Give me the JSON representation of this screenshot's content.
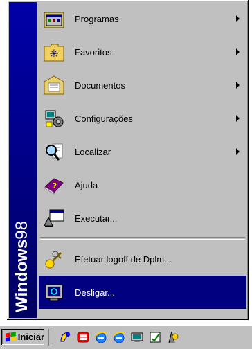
{
  "banner": {
    "brand_bold": "Windows",
    "brand_version": "98"
  },
  "menu": {
    "items": [
      {
        "label": "Programas",
        "underline_char": "P",
        "icon": "programs-folder-icon",
        "submenu": true
      },
      {
        "label": "Favoritos",
        "underline_char": "v",
        "icon": "favorites-folder-icon",
        "submenu": true
      },
      {
        "label": "Documentos",
        "underline_char": "D",
        "icon": "documents-folder-icon",
        "submenu": true
      },
      {
        "label": "Configurações",
        "underline_char": "C",
        "icon": "settings-icon",
        "submenu": true
      },
      {
        "label": "Localizar",
        "underline_char": "L",
        "icon": "find-icon",
        "submenu": true
      },
      {
        "label": "Ajuda",
        "underline_char": "A",
        "icon": "help-book-icon",
        "submenu": false
      },
      {
        "label": "Executar...",
        "underline_char": "x",
        "icon": "run-icon",
        "submenu": false
      },
      {
        "label": "Efetuar logoff de Dplm...",
        "underline_char": "u",
        "icon": "logoff-keys-icon",
        "submenu": false
      },
      {
        "label": "Desligar...",
        "underline_char": "a",
        "icon": "shutdown-computer-icon",
        "submenu": false,
        "selected": true
      }
    ]
  },
  "taskbar": {
    "start_label": "Iniciar",
    "quick_launch": [
      "quick-launch-icon-1",
      "quick-launch-icon-2",
      "internet-explorer-icon",
      "internet-explorer-icon-2",
      "quick-launch-icon-5",
      "quick-launch-icon-6",
      "quick-launch-icon-7"
    ]
  },
  "colors": {
    "menu_bg": "#c0c0c0",
    "banner": "#000080",
    "selection": "#000080"
  }
}
